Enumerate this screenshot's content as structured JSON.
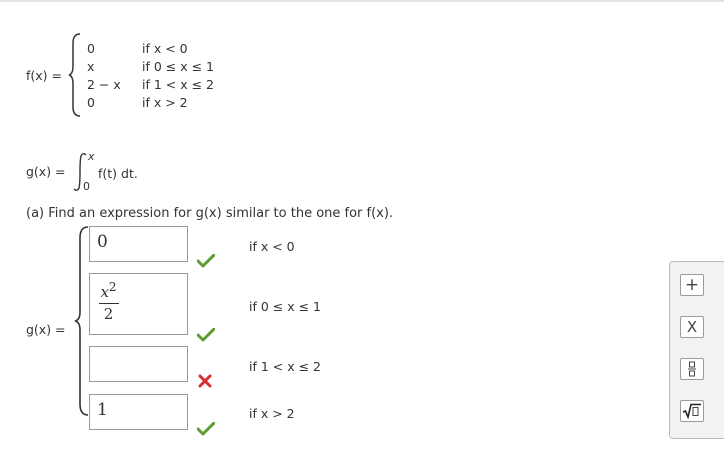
{
  "fx": {
    "lhs": "f(x) =",
    "cases": [
      {
        "expr": "0",
        "cond": "if x < 0"
      },
      {
        "expr": "x",
        "cond": "if 0 ≤ x ≤ 1"
      },
      {
        "expr": "2 − x",
        "cond": "if 1 < x ≤ 2"
      },
      {
        "expr": "0",
        "cond": "if x > 2"
      }
    ]
  },
  "gx": {
    "lhs": "g(x) =",
    "upper": "x",
    "lower": "0",
    "integrand": "f(t) dt."
  },
  "part_a": {
    "prompt": "(a) Find an expression for g(x) similar to the one for f(x).",
    "lhs": "g(x) =",
    "answers": [
      {
        "value": "0",
        "cond": "if x < 0",
        "status": "correct"
      },
      {
        "numerator": "x",
        "exponent": "2",
        "denominator": "2",
        "cond": "if 0 ≤ x ≤ 1",
        "status": "correct"
      },
      {
        "value": "",
        "cond": "if 1 < x ≤ 2",
        "status": "incorrect"
      },
      {
        "value": "1",
        "cond": "if x > 2",
        "status": "correct"
      }
    ]
  },
  "palette": {
    "plus": "+",
    "times": "X",
    "fraction": "□/□",
    "sqrt": "√□"
  },
  "colors": {
    "correct": "#5b9d32",
    "incorrect": "#d63030"
  }
}
